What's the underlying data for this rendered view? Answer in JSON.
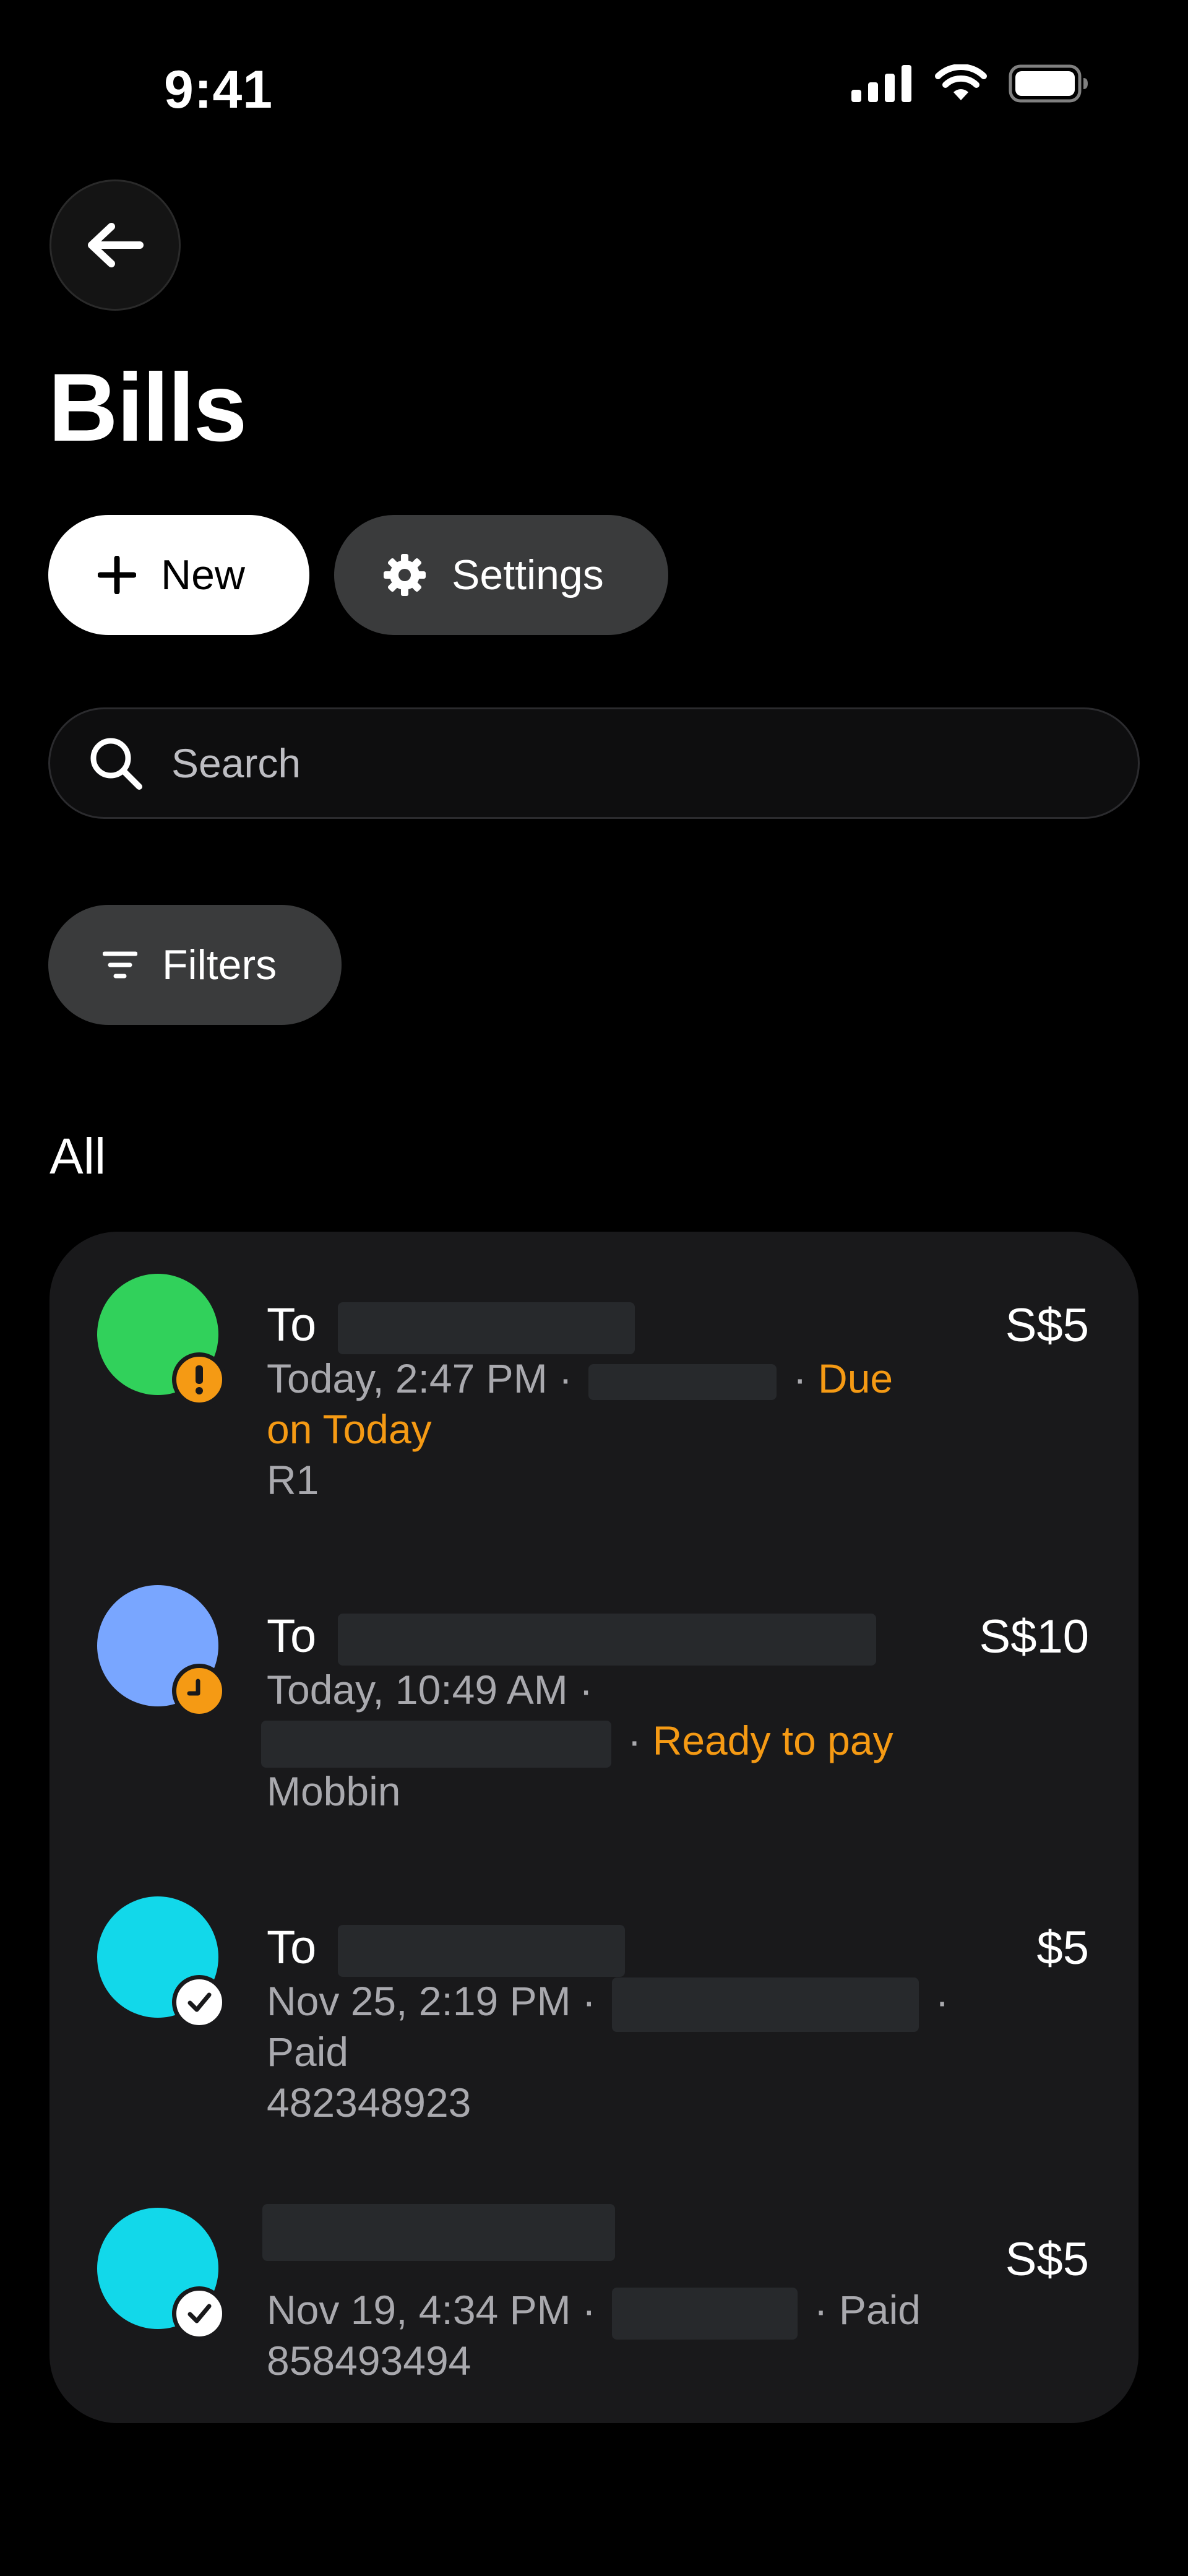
{
  "status_bar": {
    "time": "9:41"
  },
  "header": {
    "title": "Bills"
  },
  "actions": {
    "new_label": "New",
    "settings_label": "Settings"
  },
  "search": {
    "placeholder": "Search"
  },
  "filters": {
    "label": "Filters"
  },
  "section": {
    "title": "All"
  },
  "bills": [
    {
      "title_prefix": "To",
      "datetime": "Today, 2:47 PM ·",
      "sep": "·",
      "status": "Due",
      "status_cont": "on Today",
      "reference": "R1",
      "amount": "S$5",
      "avatar_color": "#31d15b",
      "badge": "exclamation-icon"
    },
    {
      "title_prefix": "To",
      "datetime": "Today, 10:49 AM ·",
      "sep": "·",
      "status": "Ready to pay",
      "reference": "Mobbin",
      "amount": "S$10",
      "avatar_color": "#79a6ff",
      "badge": "clock-icon"
    },
    {
      "title_prefix": "To",
      "datetime": "Nov 25, 2:19 PM ·",
      "sep": "·",
      "status": "Paid",
      "reference": "482348923",
      "amount": "$5",
      "avatar_color": "#12d8ea",
      "badge": "check-icon"
    },
    {
      "datetime": "Nov 19, 4:34 PM ·",
      "sep": "· Paid",
      "reference": "858493494",
      "amount": "S$5",
      "avatar_color": "#12d8ea",
      "badge": "check-icon"
    }
  ],
  "colors": {
    "accent": "#f59a14",
    "card": "#19191b",
    "pill": "#3a3b3c"
  }
}
